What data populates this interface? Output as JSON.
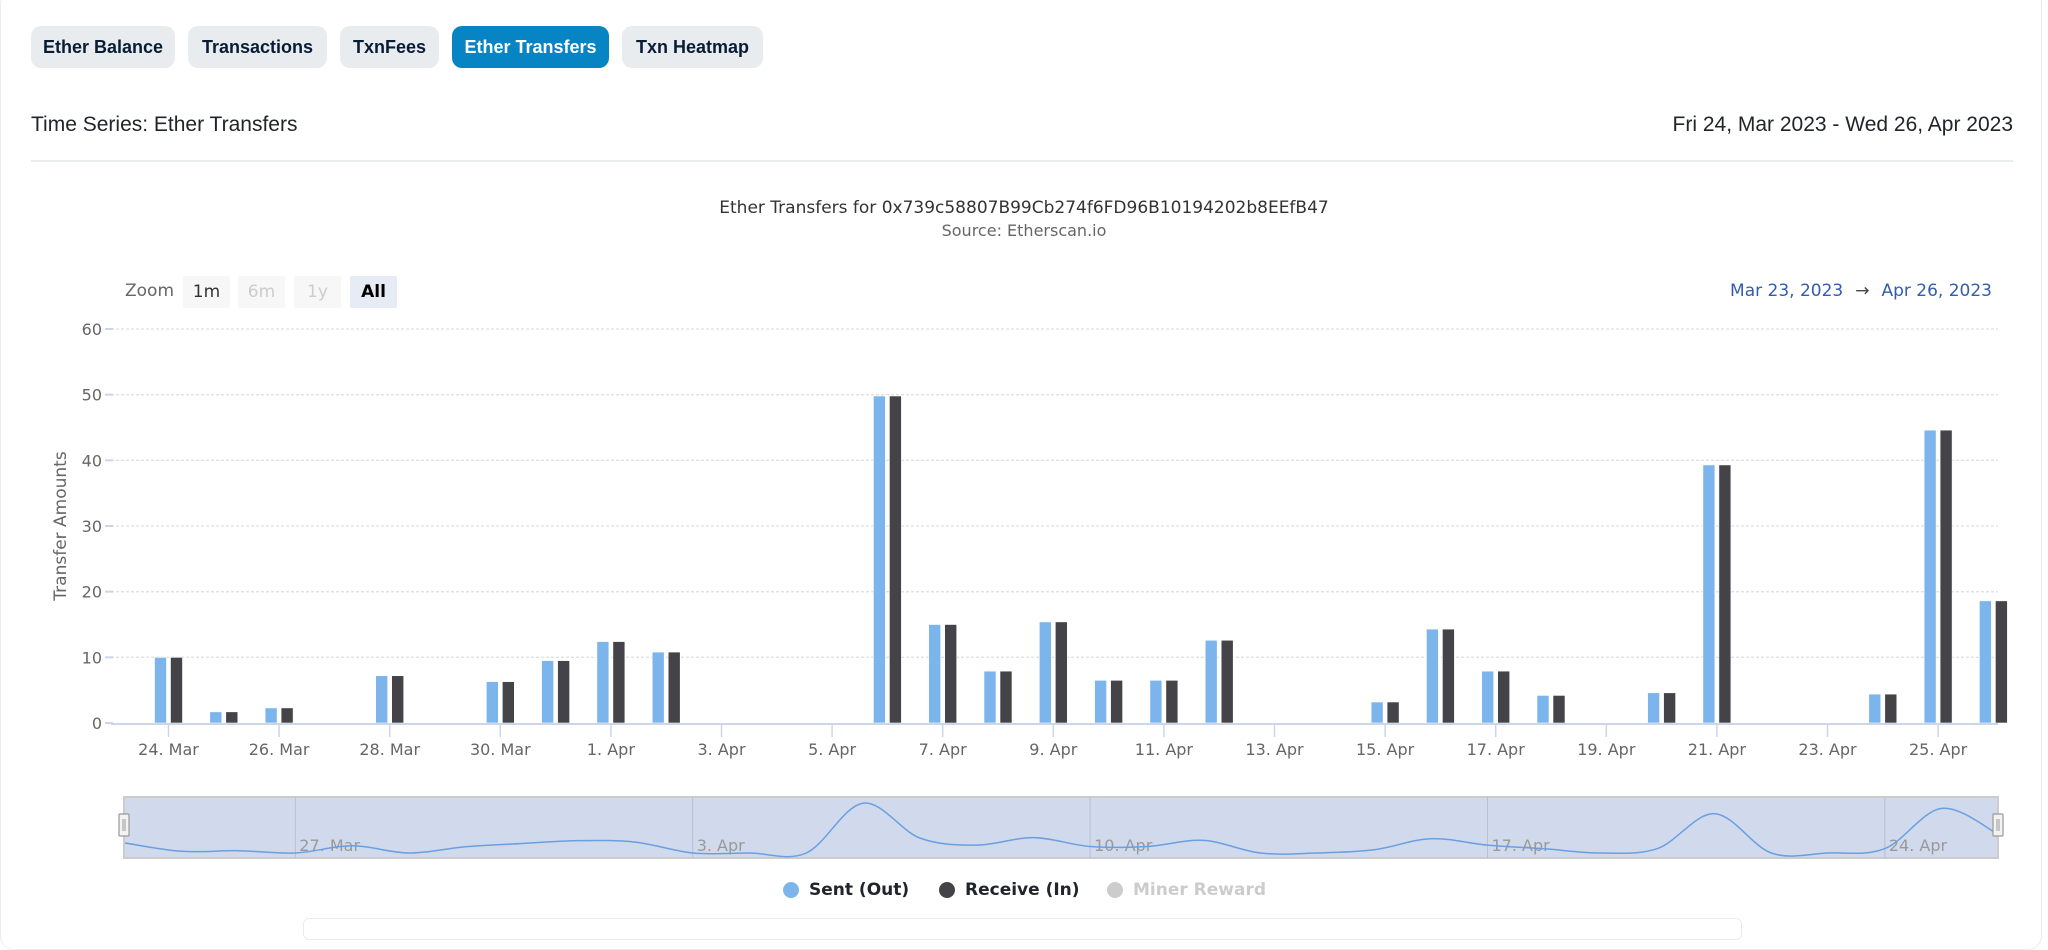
{
  "tabs": [
    {
      "label": "Ether Balance",
      "active": false
    },
    {
      "label": "Transactions",
      "active": false
    },
    {
      "label": "TxnFees",
      "active": false
    },
    {
      "label": "Ether Transfers",
      "active": true
    },
    {
      "label": "Txn Heatmap",
      "active": false
    }
  ],
  "header": {
    "title": "Time Series: Ether Transfers",
    "date_range": "Fri 24, Mar 2023 - Wed 26, Apr 2023"
  },
  "zoom": {
    "label": "Zoom",
    "buttons": [
      {
        "label": "1m",
        "state": "normal"
      },
      {
        "label": "6m",
        "state": "disabled"
      },
      {
        "label": "1y",
        "state": "disabled"
      },
      {
        "label": "All",
        "state": "selected"
      }
    ],
    "from": "Mar 23, 2023",
    "arrow": "→",
    "to": "Apr 26, 2023"
  },
  "colors": {
    "sent": "#7cb5ec",
    "receive": "#434348",
    "miner": "#cccccc",
    "accent": "#0784c3"
  },
  "chart_data": {
    "type": "bar",
    "title": "Ether Transfers for 0x739c58807B99Cb274f6FD96B10194202b8EEfB47",
    "subtitle": "Source: Etherscan.io",
    "xlabel": "",
    "ylabel": "Transfer Amounts",
    "ylim": [
      0,
      60
    ],
    "yticks": [
      "0",
      "10",
      "20",
      "30",
      "40",
      "50",
      "60"
    ],
    "grid": true,
    "legend_position": "bottom-center",
    "categories": [
      "24 Mar",
      "25 Mar",
      "26 Mar",
      "27 Mar",
      "28 Mar",
      "29 Mar",
      "30 Mar",
      "31 Mar",
      "1 Apr",
      "2 Apr",
      "3 Apr",
      "4 Apr",
      "5 Apr",
      "6 Apr",
      "7 Apr",
      "8 Apr",
      "9 Apr",
      "10 Apr",
      "11 Apr",
      "12 Apr",
      "13 Apr",
      "14 Apr",
      "15 Apr",
      "16 Apr",
      "17 Apr",
      "18 Apr",
      "19 Apr",
      "20 Apr",
      "21 Apr",
      "22 Apr",
      "23 Apr",
      "24 Apr",
      "25 Apr",
      "26 Apr"
    ],
    "xticks": [
      {
        "index": 0,
        "label": "24. Mar"
      },
      {
        "index": 2,
        "label": "26. Mar"
      },
      {
        "index": 4,
        "label": "28. Mar"
      },
      {
        "index": 6,
        "label": "30. Mar"
      },
      {
        "index": 8,
        "label": "1. Apr"
      },
      {
        "index": 10,
        "label": "3. Apr"
      },
      {
        "index": 12,
        "label": "5. Apr"
      },
      {
        "index": 14,
        "label": "7. Apr"
      },
      {
        "index": 16,
        "label": "9. Apr"
      },
      {
        "index": 18,
        "label": "11. Apr"
      },
      {
        "index": 20,
        "label": "13. Apr"
      },
      {
        "index": 22,
        "label": "15. Apr"
      },
      {
        "index": 24,
        "label": "17. Apr"
      },
      {
        "index": 26,
        "label": "19. Apr"
      },
      {
        "index": 28,
        "label": "21. Apr"
      },
      {
        "index": 30,
        "label": "23. Apr"
      },
      {
        "index": 32,
        "label": "25. Apr"
      }
    ],
    "series": [
      {
        "name": "Sent (Out)",
        "values": [
          10,
          1.7,
          2.3,
          0,
          7.2,
          0,
          6.3,
          9.5,
          12.4,
          10.8,
          0,
          0,
          0,
          49.8,
          15,
          7.9,
          15.4,
          6.5,
          6.5,
          12.6,
          0,
          0,
          3.2,
          14.3,
          7.9,
          4.2,
          0,
          4.6,
          39.3,
          0,
          0,
          4.4,
          44.6,
          18.6
        ]
      },
      {
        "name": "Receive (In)",
        "values": [
          10,
          1.7,
          2.3,
          0,
          7.2,
          0,
          6.3,
          9.5,
          12.4,
          10.8,
          0,
          0,
          0,
          49.8,
          15,
          7.9,
          15.4,
          6.5,
          6.5,
          12.6,
          0,
          0,
          3.2,
          14.3,
          7.9,
          4.2,
          0,
          4.6,
          39.3,
          0,
          0,
          4.4,
          44.6,
          18.6
        ]
      },
      {
        "name": "Miner Reward",
        "values": [],
        "hidden": true
      }
    ],
    "navigator": {
      "labels": [
        {
          "index": 3,
          "label": "27. Mar"
        },
        {
          "index": 10,
          "label": "3. Apr"
        },
        {
          "index": 17,
          "label": "10. Apr"
        },
        {
          "index": 24,
          "label": "17. Apr"
        },
        {
          "index": 31,
          "label": "24. Apr"
        }
      ]
    }
  }
}
